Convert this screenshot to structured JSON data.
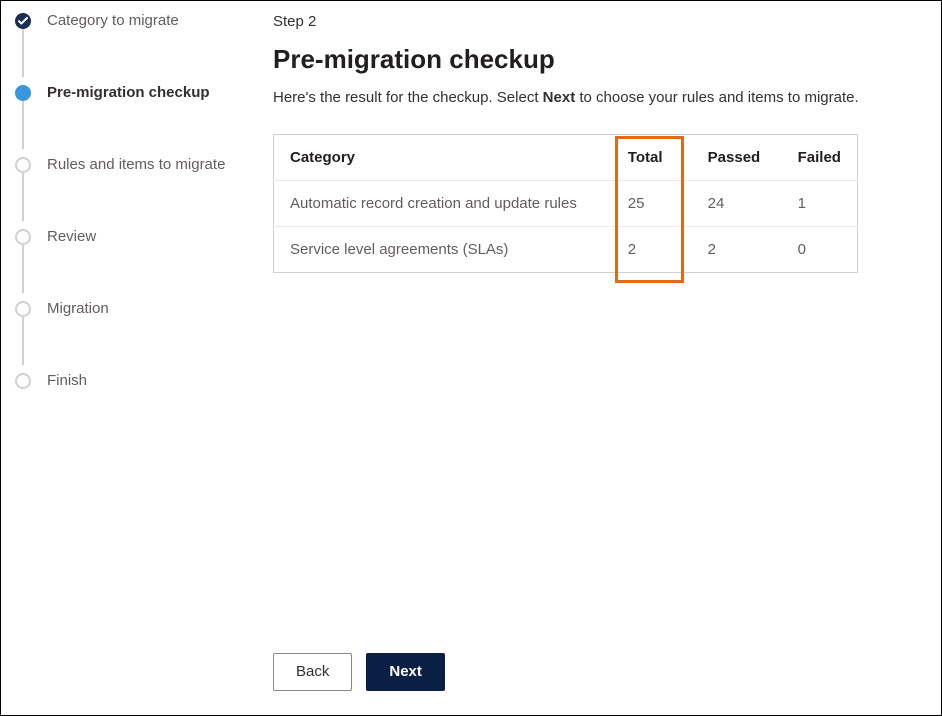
{
  "stepper": {
    "items": [
      {
        "label": "Category to migrate",
        "state": "done"
      },
      {
        "label": "Pre-migration checkup",
        "state": "current"
      },
      {
        "label": "Rules and items to migrate",
        "state": "pending"
      },
      {
        "label": "Review",
        "state": "pending"
      },
      {
        "label": "Migration",
        "state": "pending"
      },
      {
        "label": "Finish",
        "state": "pending"
      }
    ]
  },
  "main": {
    "step_indicator": "Step 2",
    "title": "Pre-migration checkup",
    "description_pre": "Here's the result for the checkup. Select ",
    "description_bold": "Next",
    "description_post": " to choose your rules and items to migrate."
  },
  "table": {
    "headers": {
      "category": "Category",
      "total": "Total",
      "passed": "Passed",
      "failed": "Failed"
    },
    "rows": [
      {
        "category": "Automatic record creation and update rules",
        "total": "25",
        "passed": "24",
        "failed": "1"
      },
      {
        "category": "Service level agreements (SLAs)",
        "total": "2",
        "passed": "2",
        "failed": "0"
      }
    ]
  },
  "buttons": {
    "back": "Back",
    "next": "Next"
  }
}
